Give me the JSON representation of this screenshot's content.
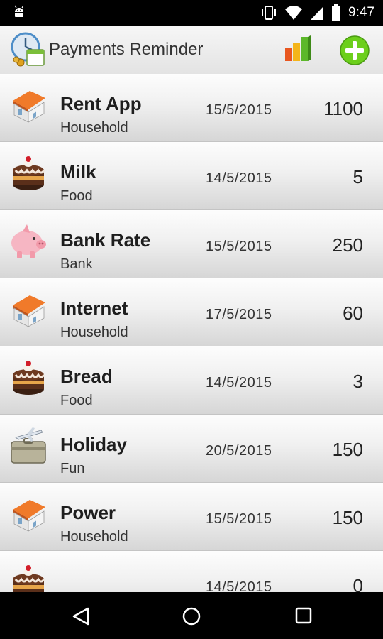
{
  "status_bar": {
    "time": "9:47",
    "icons": [
      "android-debug-icon",
      "vibrate-icon",
      "wifi-icon",
      "signal-icon",
      "battery-icon"
    ]
  },
  "action_bar": {
    "title": "Payments Reminder",
    "icons": [
      "app-clock-calendar-icon",
      "bar-chart-icon",
      "add-icon"
    ],
    "accent": "#6ccf1b"
  },
  "payments": [
    {
      "name": "Rent App",
      "category": "Household",
      "date": "15/5/2015",
      "amount": "1100",
      "icon": "house-icon"
    },
    {
      "name": "Milk",
      "category": "Food",
      "date": "14/5/2015",
      "amount": "5",
      "icon": "cake-icon"
    },
    {
      "name": "Bank Rate",
      "category": "Bank",
      "date": "15/5/2015",
      "amount": "250",
      "icon": "piggy-bank-icon"
    },
    {
      "name": "Internet",
      "category": "Household",
      "date": "17/5/2015",
      "amount": "60",
      "icon": "house-icon"
    },
    {
      "name": "Bread",
      "category": "Food",
      "date": "14/5/2015",
      "amount": "3",
      "icon": "cake-icon"
    },
    {
      "name": "Holiday",
      "category": "Fun",
      "date": "20/5/2015",
      "amount": "150",
      "icon": "suitcase-plane-icon"
    },
    {
      "name": "Power",
      "category": "Household",
      "date": "15/5/2015",
      "amount": "150",
      "icon": "house-icon"
    },
    {
      "name": "",
      "category": "",
      "date": "14/5/2015",
      "amount": "0",
      "icon": "cake-icon"
    }
  ],
  "nav_bar": {
    "icons": [
      "back-icon",
      "home-icon",
      "recents-icon"
    ]
  }
}
